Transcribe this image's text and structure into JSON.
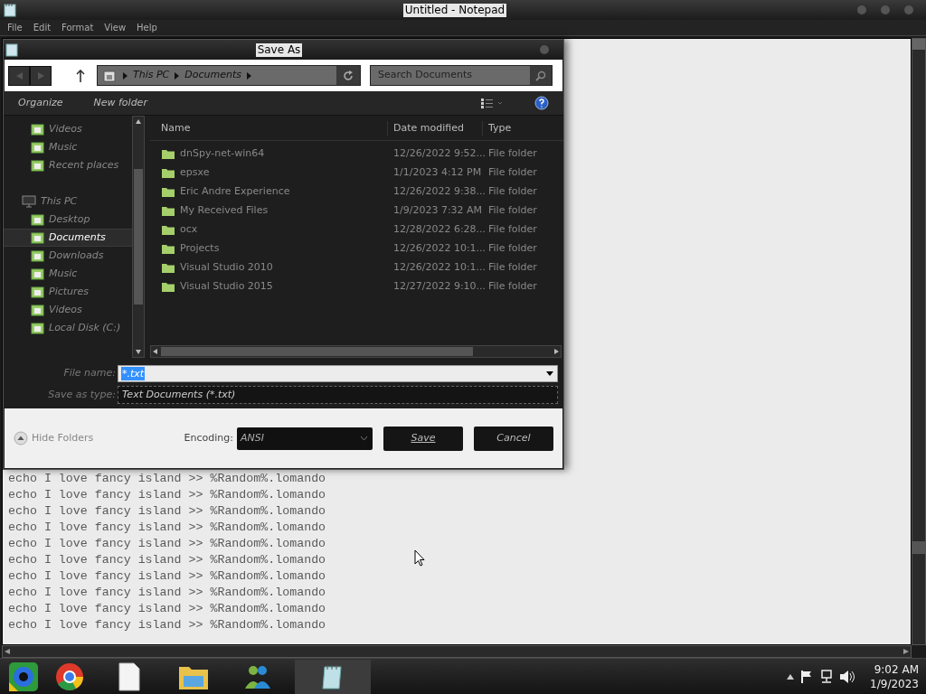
{
  "notepad": {
    "title": "Untitled - Notepad",
    "menu": [
      "File",
      "Edit",
      "Format",
      "View",
      "Help"
    ],
    "lines": [
      "echo I love fancy island >> %Random%.lomando",
      "echo I love fancy island >> %Random%.lomando",
      "echo I love fancy island >> %Random%.lomando",
      "echo I love fancy island >> %Random%.lomando",
      "echo I love fancy island >> %Random%.lomando",
      "echo I love fancy island >> %Random%.lomando",
      "echo I love fancy island >> %Random%.lomando",
      "echo I love fancy island >> %Random%.lomando",
      "echo I love fancy island >> %Random%.lomando",
      "echo I love fancy island >> %Random%.lomando"
    ]
  },
  "dialog": {
    "title": "Save As",
    "breadcrumb": [
      "This PC",
      "Documents"
    ],
    "search": {
      "placeholder": "Search Documents"
    },
    "toolbar": [
      "Organize",
      "New folder"
    ],
    "sidebar": [
      {
        "label": "Videos",
        "selected": false
      },
      {
        "label": "Music",
        "selected": false
      },
      {
        "label": "Recent places",
        "selected": false
      },
      {
        "label": "This PC",
        "selected": false,
        "children": [
          {
            "label": "Desktop",
            "selected": false
          },
          {
            "label": "Documents",
            "selected": true
          },
          {
            "label": "Downloads",
            "selected": false
          },
          {
            "label": "Music",
            "selected": false
          },
          {
            "label": "Pictures",
            "selected": false
          },
          {
            "label": "Videos",
            "selected": false
          },
          {
            "label": "Local Disk (C:)",
            "selected": false
          }
        ]
      }
    ],
    "columns": [
      "Name",
      "Date modified",
      "Type"
    ],
    "rows": [
      [
        "dnSpy-net-win64",
        "12/26/2022 9:52...",
        "File folder"
      ],
      [
        "epsxe",
        "1/1/2023 4:12 PM",
        "File folder"
      ],
      [
        "Eric Andre Experience",
        "12/26/2022 9:38...",
        "File folder"
      ],
      [
        "My Received Files",
        "1/9/2023 7:32 AM",
        "File folder"
      ],
      [
        "ocx",
        "12/28/2022 6:28...",
        "File folder"
      ],
      [
        "Projects",
        "12/26/2022 10:1...",
        "File folder"
      ],
      [
        "Visual Studio 2010",
        "12/26/2022 10:1...",
        "File folder"
      ],
      [
        "Visual Studio 2015",
        "12/27/2022 9:10...",
        "File folder"
      ]
    ],
    "file_name": {
      "label": "File name:",
      "value": "*.txt"
    },
    "save_as_type": {
      "label": "Save as type:",
      "value": "Text Documents (*.txt)"
    },
    "hide_folders": "Hide Folders",
    "encoding": {
      "label": "Encoding:",
      "value": "ANSI"
    },
    "buttons": [
      "Save",
      "Cancel"
    ]
  },
  "taskbar": {
    "time": "9:02 AM",
    "date": "1/9/2023"
  }
}
